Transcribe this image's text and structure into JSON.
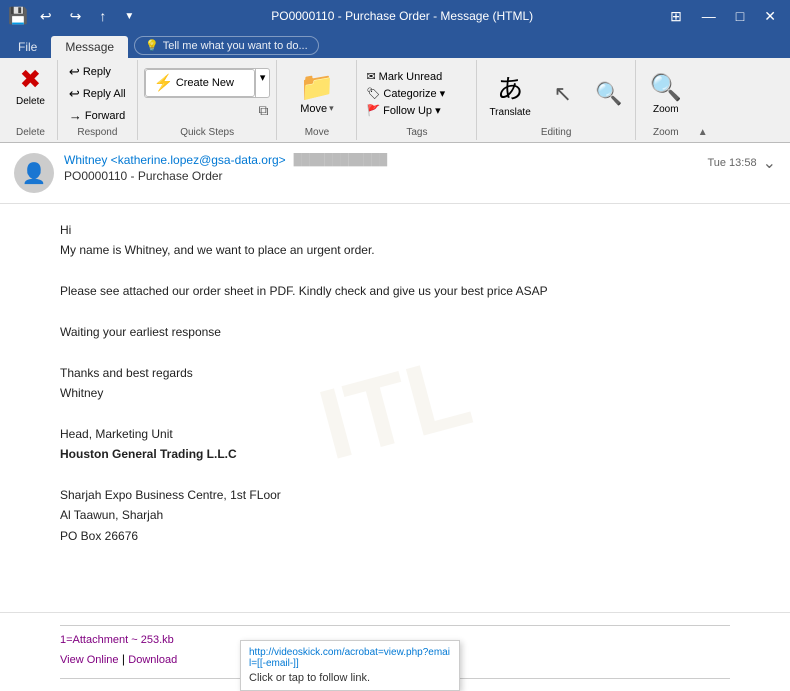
{
  "titleBar": {
    "title": "PO0000110 - Purchase Order  -  Message (HTML)",
    "saveIcon": "💾",
    "undoIcon": "↩",
    "redoIcon": "↪",
    "upIcon": "↑",
    "windowIcon": "⊞",
    "minimizeIcon": "—",
    "maximizeIcon": "□",
    "closeIcon": "✕",
    "customizeIcon": "▼"
  },
  "tabs": [
    {
      "label": "File",
      "active": false
    },
    {
      "label": "Message",
      "active": true
    },
    {
      "label": "Tell me what you want to do...",
      "active": false,
      "isTellMe": true
    }
  ],
  "ribbon": {
    "groups": [
      {
        "id": "delete",
        "label": "Delete",
        "buttons": [
          {
            "id": "delete-btn",
            "icon": "✕",
            "label": "Delete",
            "size": "lg"
          }
        ]
      },
      {
        "id": "respond",
        "label": "Respond",
        "buttons": [
          {
            "id": "reply-btn",
            "icon": "↩",
            "label": "Reply",
            "size": "sm"
          },
          {
            "id": "reply-all-btn",
            "icon": "↩↩",
            "label": "Reply All",
            "size": "sm"
          },
          {
            "id": "forward-btn",
            "icon": "→",
            "label": "Forward",
            "size": "sm"
          }
        ]
      },
      {
        "id": "quick-steps",
        "label": "Quick Steps",
        "mainBtn": "Create New",
        "mainIcon": "⚡"
      },
      {
        "id": "move",
        "label": "Move",
        "folderIcon": "📁",
        "label2": "Move"
      },
      {
        "id": "tags",
        "label": "Tags",
        "buttons": [
          {
            "id": "mark-unread-btn",
            "icon": "✉",
            "label": "Mark Unread"
          },
          {
            "id": "categorize-btn",
            "icon": "🏷",
            "label": "Categorize ▾"
          },
          {
            "id": "follow-up-btn",
            "icon": "🚩",
            "label": "Follow Up ▾"
          }
        ]
      },
      {
        "id": "editing",
        "label": "Editing",
        "translateLabel": "Translate",
        "searchLabel": ""
      },
      {
        "id": "zoom",
        "label": "Zoom",
        "zoomLabel": "Zoom"
      }
    ]
  },
  "email": {
    "from": "Whitney <katherine.lopez@gsa-data.org>",
    "redacted": "████████████",
    "timestamp": "Tue 13:58",
    "subject": "PO0000110 - Purchase Order",
    "avatarIcon": "👤",
    "body": {
      "greeting": "Hi",
      "line1": "My name is Whitney, and we want to place an urgent order.",
      "line2": "",
      "line3": "Please see attached our order sheet in PDF. Kindly check and give us your best price ASAP",
      "line4": "",
      "line5": "Waiting your earliest response",
      "line6": "",
      "line7": "Thanks and best regards",
      "line8": "Whitney",
      "line9": "",
      "line10": "Head, Marketing Unit",
      "line11": "Houston General Trading L.L.C",
      "line12": "",
      "line13": "Sharjah Expo Business Centre, 1st FLoor",
      "line14": "Al Taawun, Sharjah",
      "line15": "PO Box 26676"
    },
    "attachment": {
      "label": "1=Attachment ~ 253.kb",
      "viewOnline": "View Online",
      "pipe": " | ",
      "download": "Download"
    },
    "tooltip": {
      "url": "http://videoskick.com/acrobat=view.php?email=[[‑email‑]]",
      "hint": "Click or tap to follow link."
    }
  }
}
